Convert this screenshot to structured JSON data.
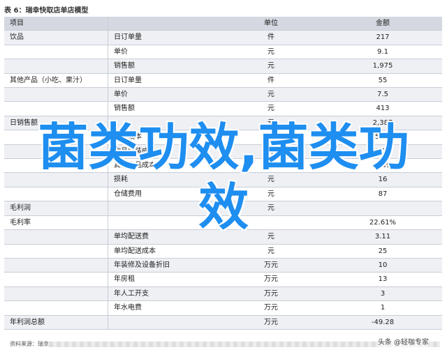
{
  "caption": "表 6：瑞幸快取店单店模型",
  "headers": [
    "项目",
    "",
    "单位",
    "金额"
  ],
  "rows": [
    [
      "饮品",
      "日订单量",
      "件",
      "217"
    ],
    [
      "",
      "单价",
      "元",
      "9.1"
    ],
    [
      "",
      "销售额",
      "元",
      "1,975"
    ],
    [
      "其他产品（小吃、果汁）",
      "日订单量",
      "件",
      "55"
    ],
    [
      "",
      "单价",
      "元",
      "7.5"
    ],
    [
      "",
      "销售额",
      "元",
      "413"
    ],
    [
      "日销售额",
      "",
      "元",
      "2,387"
    ],
    [
      "",
      "食品成本",
      "元",
      "5.90"
    ],
    [
      "",
      "饮品包装成本",
      "元",
      "5.70"
    ],
    [
      "",
      "其他产品成本",
      "元",
      "0.69"
    ],
    [
      "",
      "损耗",
      "元",
      "16"
    ],
    [
      "",
      "仓储费用",
      "元",
      "87"
    ],
    [
      "毛利润",
      "",
      "元",
      ""
    ],
    [
      "毛利率",
      "",
      "",
      "22.61%"
    ],
    [
      "",
      "单均配送费",
      "元",
      "3.11"
    ],
    [
      "",
      "单均配送成本",
      "元",
      "25"
    ],
    [
      "",
      "年装修及设备折旧",
      "万元",
      "10"
    ],
    [
      "",
      "年房租",
      "万元",
      "13"
    ],
    [
      "",
      "年人工开支",
      "万元",
      "3"
    ],
    [
      "",
      "年水电费",
      "万元",
      "1"
    ],
    [
      "年利润总额",
      "",
      "万元",
      "-49.28"
    ]
  ],
  "footer_source": "资料来源：瑞幸",
  "watermark": "头条 @轻咖专家",
  "overlay_text": "菌类功效,菌类功效",
  "colors": {
    "header_bg": "#d3d8e1",
    "overlay": "#1e8ef0"
  }
}
